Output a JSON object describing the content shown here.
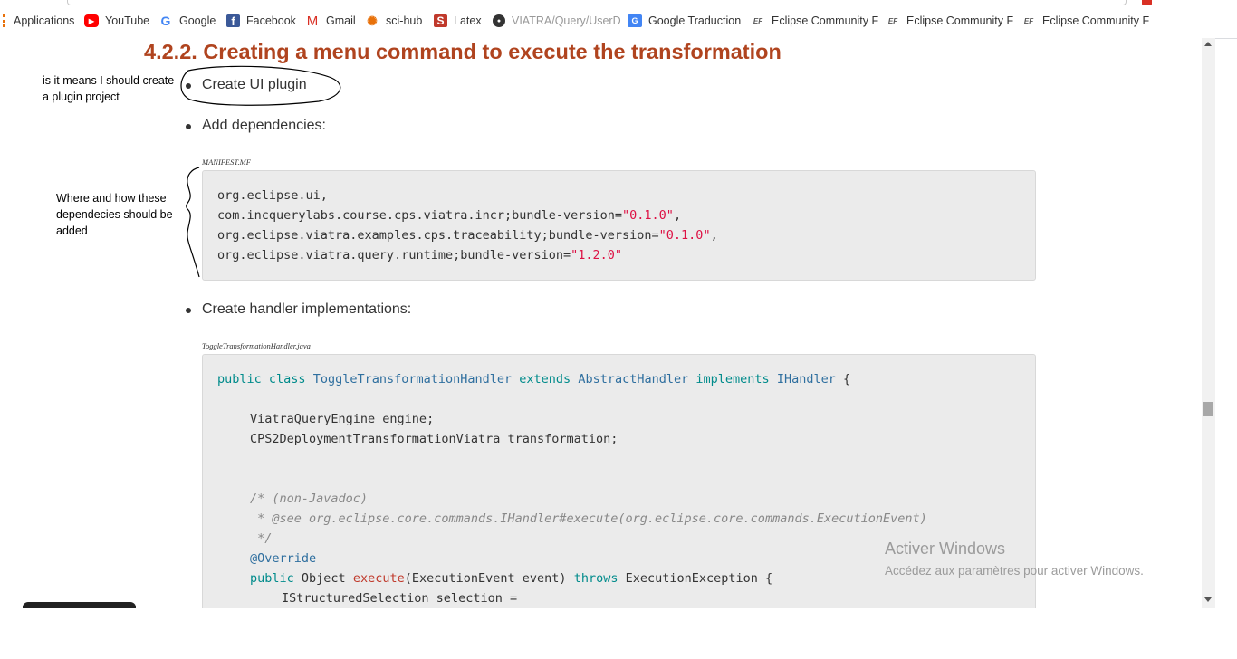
{
  "bookmarks": [
    {
      "label": "Applications",
      "icon": "apps-grid-icon"
    },
    {
      "label": "YouTube",
      "icon": "youtube-icon"
    },
    {
      "label": "Google",
      "icon": "google-icon"
    },
    {
      "label": "Facebook",
      "icon": "facebook-icon"
    },
    {
      "label": "Gmail",
      "icon": "gmail-icon"
    },
    {
      "label": "sci-hub",
      "icon": "sci-hub-icon"
    },
    {
      "label": "Latex",
      "icon": "latex-icon"
    },
    {
      "label": "VIATRA/Query/UserD",
      "icon": "viatra-icon"
    },
    {
      "label": "Google Traduction",
      "icon": "google-translate-icon"
    },
    {
      "label": "Eclipse Community F",
      "icon": "eclipse-forum-icon"
    },
    {
      "label": "Eclipse Community F",
      "icon": "eclipse-forum-icon"
    },
    {
      "label": "Eclipse Community F",
      "icon": "eclipse-forum-icon"
    }
  ],
  "page": {
    "heading": "4.2.2. Creating a menu command to execute the transformation",
    "bullets": [
      "Create UI plugin",
      "Add dependencies:",
      "Create handler implementations:"
    ],
    "manifest_caption": "MANIFEST.MF",
    "manifest_lines": [
      {
        "pre": "org.eclipse.ui,",
        "str": "",
        "post": ""
      },
      {
        "pre": "com.incquerylabs.course.cps.viatra.incr;bundle-version=",
        "str": "\"0.1.0\"",
        "post": ","
      },
      {
        "pre": "org.eclipse.viatra.examples.cps.traceability;bundle-version=",
        "str": "\"0.1.0\"",
        "post": ","
      },
      {
        "pre": "org.eclipse.viatra.query.runtime;bundle-version=",
        "str": "\"1.2.0\"",
        "post": ""
      }
    ],
    "handler_caption": "ToggleTransformationHandler.java",
    "code": {
      "l1": {
        "kw1": "public class",
        "name": "ToggleTransformationHandler",
        "kw2": "extends",
        "base": "AbstractHandler",
        "kw3": "implements",
        "iface": "IHandler",
        "tail": "{"
      },
      "l2": "ViatraQueryEngine engine;",
      "l3": "CPS2DeploymentTransformationViatra transformation;",
      "l4": "/* (non-Javadoc)",
      "l5": " * @see org.eclipse.core.commands.IHandler#execute(org.eclipse.core.commands.ExecutionEvent)",
      "l6": " */",
      "l7": "@Override",
      "l8": {
        "kw1": "public",
        "t1": "Object",
        "fn": "execute",
        "args": "(ExecutionEvent event)",
        "kw2": "throws",
        "t2": "ExecutionException {"
      },
      "l9": "IStructuredSelection selection ="
    }
  },
  "annotations": {
    "note1": "is it means I should create a plugin project",
    "note2": "Where and how these dependecies should be added"
  },
  "watermark": {
    "title": "Activer Windows",
    "subtitle": "Accédez aux paramètres pour activer Windows."
  }
}
